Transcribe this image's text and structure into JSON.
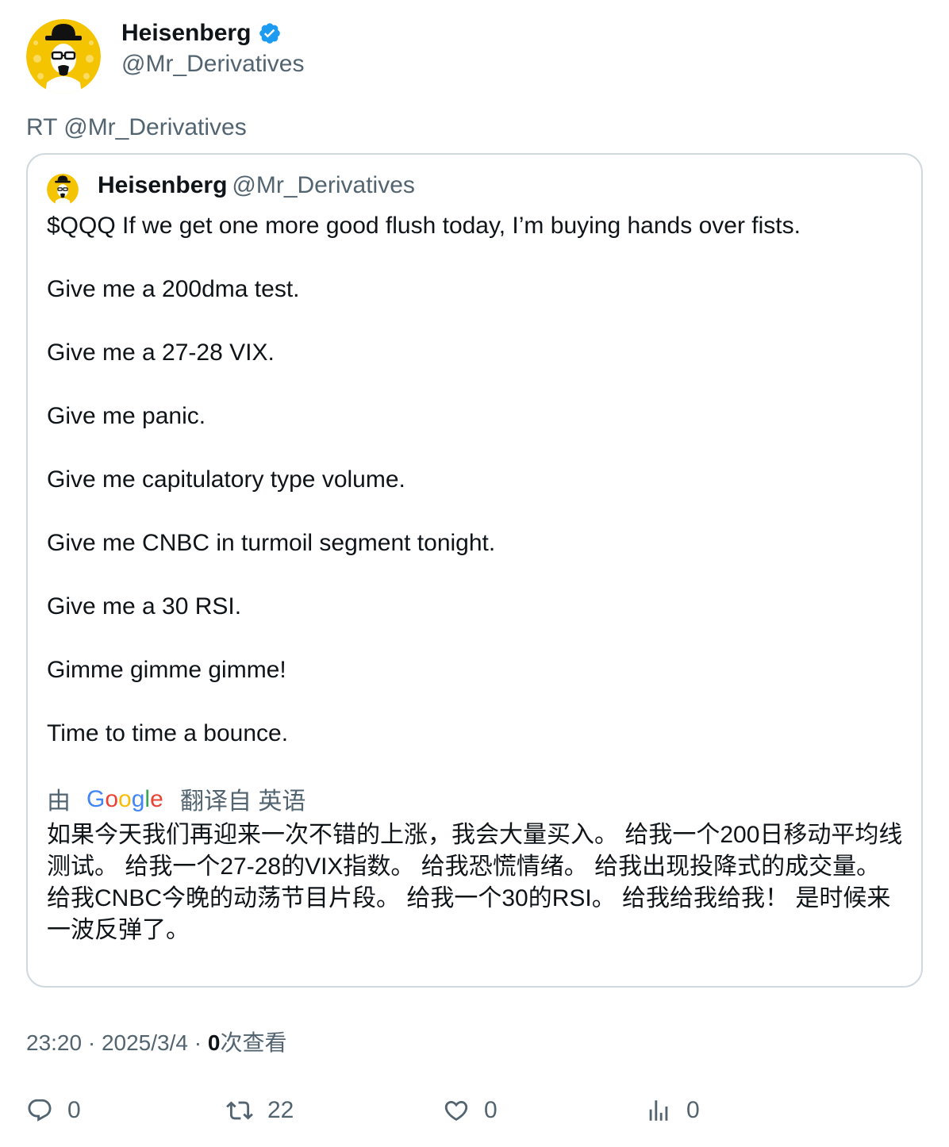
{
  "author": {
    "display_name": "Heisenberg",
    "handle": "@Mr_Derivatives"
  },
  "retweet_text": "RT @Mr_Derivatives",
  "quoted": {
    "display_name": "Heisenberg",
    "handle": "@Mr_Derivatives",
    "lines": [
      "$QQQ If we get one more good flush today, I’m buying hands over fists.",
      "Give me a 200dma test.",
      "Give me a 27-28 VIX.",
      "Give me panic.",
      "Give me capitulatory type volume.",
      "Give me CNBC in turmoil segment tonight.",
      "Give me a 30 RSI.",
      "Gimme gimme gimme!",
      "Time to time a bounce."
    ],
    "translation_prefix": "由",
    "translation_suffix": "翻译自 英语",
    "translated_text": "如果今天我们再迎来一次不错的上涨，我会大量买入。 给我一个200日移动平均线测试。 给我一个27-28的VIX指数。 给我恐慌情绪。 给我出现投降式的成交量。 给我CNBC今晚的动荡节目片段。 给我一个30的RSI。 给我给我给我！ 是时候来一波反弹了。"
  },
  "meta": {
    "time": "23:20",
    "separator": "·",
    "date": "2025/3/4",
    "views_count": "0",
    "views_label": "次查看"
  },
  "actions": {
    "replies": "0",
    "retweets": "22",
    "likes": "0",
    "views": "0"
  },
  "colors": {
    "text": "#0f1419",
    "secondary": "#536471",
    "verified": "#1d9bf0",
    "border": "#cfd9de",
    "avatar_bg": "#f5c400"
  }
}
